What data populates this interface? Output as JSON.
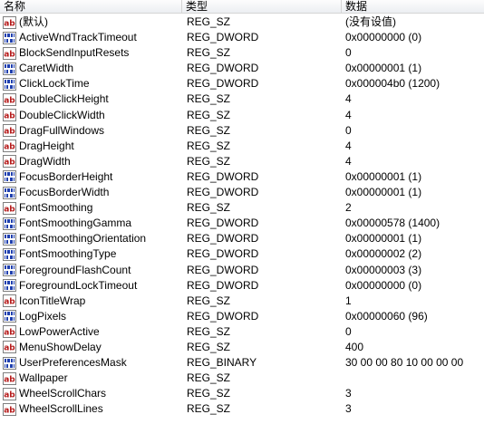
{
  "columns": {
    "name": "名称",
    "type": "类型",
    "data": "数据"
  },
  "colors": {
    "icon_border": "#7f7f7f",
    "sz_text": "#b51a1a",
    "dword_text": "#1f3fae"
  },
  "rows": [
    {
      "icon": "reg-sz-icon",
      "name": "(默认)",
      "type": "REG_SZ",
      "data": "(没有设值)"
    },
    {
      "icon": "reg-dword-icon",
      "name": "ActiveWndTrackTimeout",
      "type": "REG_DWORD",
      "data": "0x00000000 (0)"
    },
    {
      "icon": "reg-sz-icon",
      "name": "BlockSendInputResets",
      "type": "REG_SZ",
      "data": "0"
    },
    {
      "icon": "reg-dword-icon",
      "name": "CaretWidth",
      "type": "REG_DWORD",
      "data": "0x00000001 (1)"
    },
    {
      "icon": "reg-dword-icon",
      "name": "ClickLockTime",
      "type": "REG_DWORD",
      "data": "0x000004b0 (1200)"
    },
    {
      "icon": "reg-sz-icon",
      "name": "DoubleClickHeight",
      "type": "REG_SZ",
      "data": "4"
    },
    {
      "icon": "reg-sz-icon",
      "name": "DoubleClickWidth",
      "type": "REG_SZ",
      "data": "4"
    },
    {
      "icon": "reg-sz-icon",
      "name": "DragFullWindows",
      "type": "REG_SZ",
      "data": "0"
    },
    {
      "icon": "reg-sz-icon",
      "name": "DragHeight",
      "type": "REG_SZ",
      "data": "4"
    },
    {
      "icon": "reg-sz-icon",
      "name": "DragWidth",
      "type": "REG_SZ",
      "data": "4"
    },
    {
      "icon": "reg-dword-icon",
      "name": "FocusBorderHeight",
      "type": "REG_DWORD",
      "data": "0x00000001 (1)"
    },
    {
      "icon": "reg-dword-icon",
      "name": "FocusBorderWidth",
      "type": "REG_DWORD",
      "data": "0x00000001 (1)"
    },
    {
      "icon": "reg-sz-icon",
      "name": "FontSmoothing",
      "type": "REG_SZ",
      "data": "2"
    },
    {
      "icon": "reg-dword-icon",
      "name": "FontSmoothingGamma",
      "type": "REG_DWORD",
      "data": "0x00000578 (1400)"
    },
    {
      "icon": "reg-dword-icon",
      "name": "FontSmoothingOrientation",
      "type": "REG_DWORD",
      "data": "0x00000001 (1)"
    },
    {
      "icon": "reg-dword-icon",
      "name": "FontSmoothingType",
      "type": "REG_DWORD",
      "data": "0x00000002 (2)"
    },
    {
      "icon": "reg-dword-icon",
      "name": "ForegroundFlashCount",
      "type": "REG_DWORD",
      "data": "0x00000003 (3)"
    },
    {
      "icon": "reg-dword-icon",
      "name": "ForegroundLockTimeout",
      "type": "REG_DWORD",
      "data": "0x00000000 (0)"
    },
    {
      "icon": "reg-sz-icon",
      "name": "IconTitleWrap",
      "type": "REG_SZ",
      "data": "1"
    },
    {
      "icon": "reg-dword-icon",
      "name": "LogPixels",
      "type": "REG_DWORD",
      "data": "0x00000060 (96)"
    },
    {
      "icon": "reg-sz-icon",
      "name": "LowPowerActive",
      "type": "REG_SZ",
      "data": "0"
    },
    {
      "icon": "reg-sz-icon",
      "name": "MenuShowDelay",
      "type": "REG_SZ",
      "data": "400"
    },
    {
      "icon": "reg-dword-icon",
      "name": "UserPreferencesMask",
      "type": "REG_BINARY",
      "data": "30 00 00 80 10 00 00 00"
    },
    {
      "icon": "reg-sz-icon",
      "name": "Wallpaper",
      "type": "REG_SZ",
      "data": ""
    },
    {
      "icon": "reg-sz-icon",
      "name": "WheelScrollChars",
      "type": "REG_SZ",
      "data": "3"
    },
    {
      "icon": "reg-sz-icon",
      "name": "WheelScrollLines",
      "type": "REG_SZ",
      "data": "3"
    }
  ]
}
